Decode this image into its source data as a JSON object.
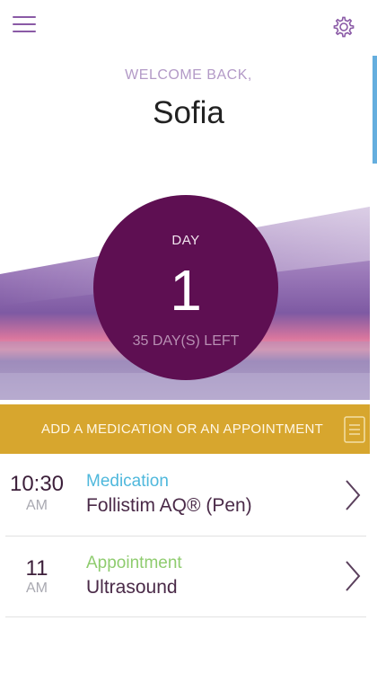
{
  "header": {
    "menu_icon": "hamburger-menu-icon",
    "settings_icon": "gear-icon"
  },
  "welcome": {
    "greeting": "WELCOME BACK,",
    "name": "Sofia"
  },
  "cycle": {
    "day_label": "DAY",
    "day_number": "1",
    "days_left": "35 DAY(S) LEFT"
  },
  "add_banner": {
    "label": "ADD A MEDICATION OR AN APPOINTMENT",
    "icon": "document-icon"
  },
  "schedule": [
    {
      "time": "10:30",
      "period": "AM",
      "type": "Medication",
      "type_color": "#4fb8dc",
      "title": "Follistim AQ® (Pen)"
    },
    {
      "time": "11",
      "period": "AM",
      "type": "Appointment",
      "type_color": "#8fcc6f",
      "title": "Ultrasound"
    }
  ],
  "colors": {
    "brand_purple": "#5e0f52",
    "accent_gold": "#d7a62e",
    "icon_purple": "#8a5aa6"
  }
}
